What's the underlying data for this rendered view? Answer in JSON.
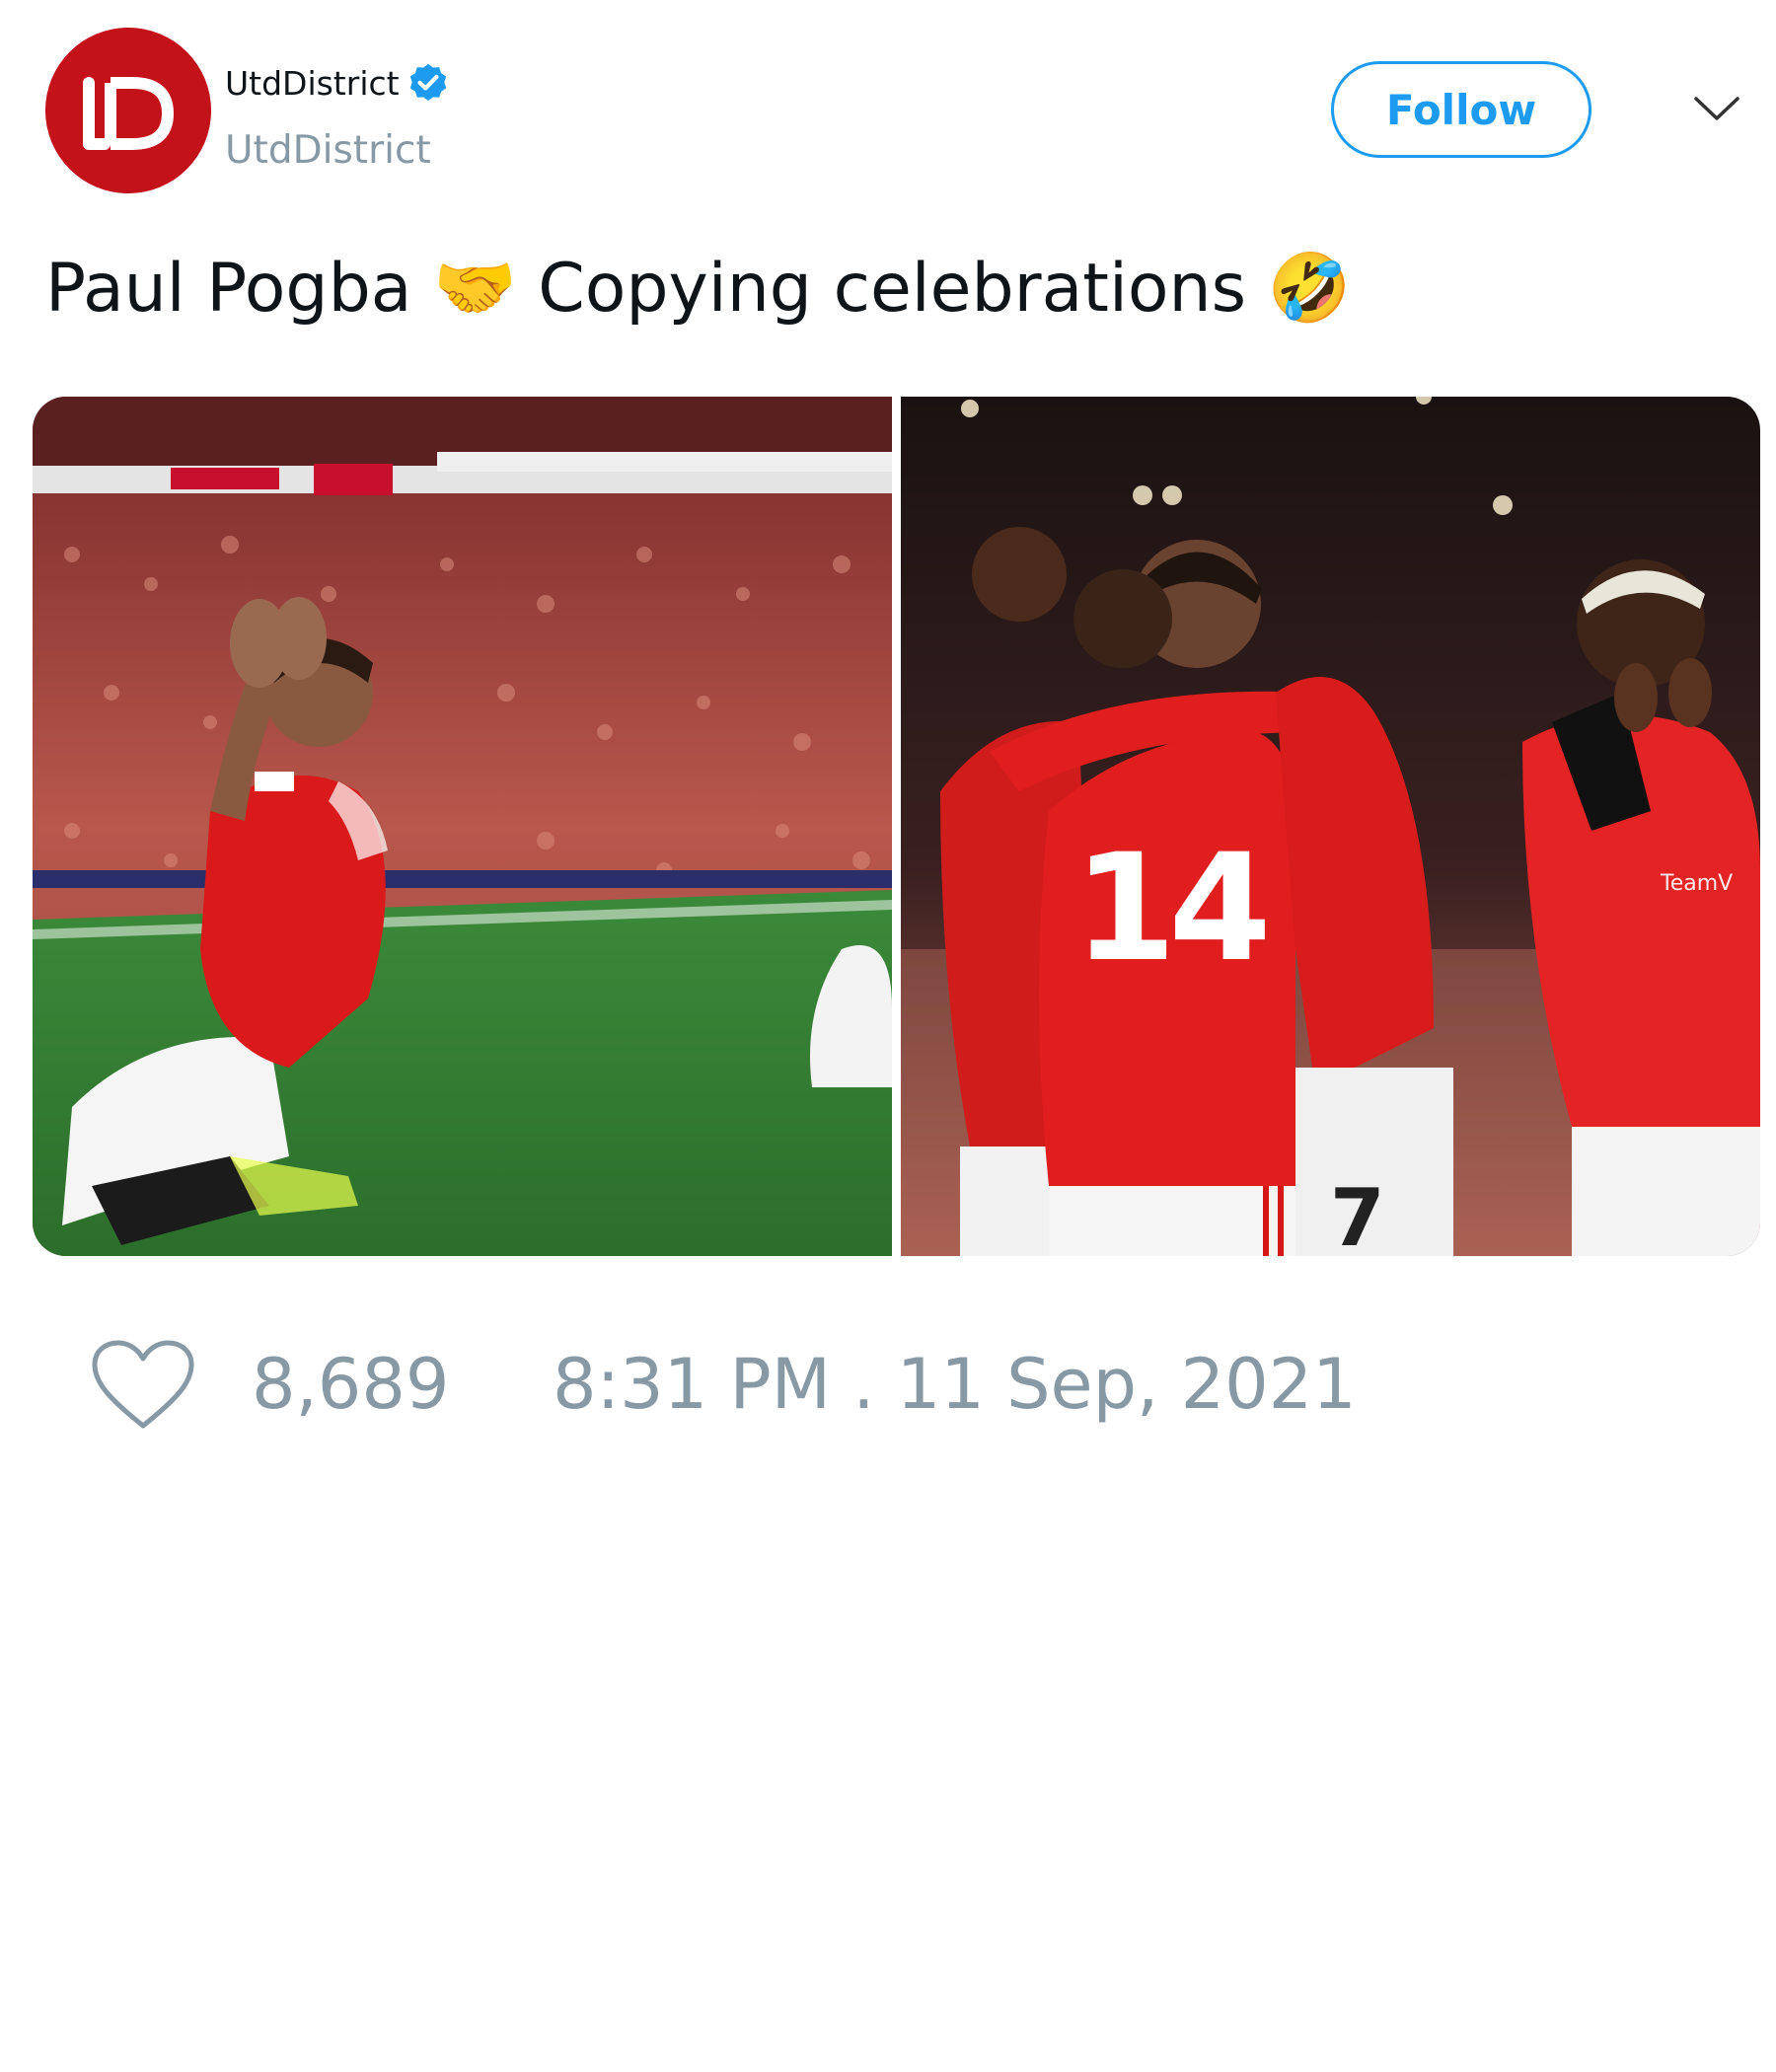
{
  "author": {
    "display_name": "UtdDistrict",
    "handle": "UtdDistrict",
    "verified": true,
    "avatar_icon": "utddistrict-logo",
    "avatar_color": "#c4121a"
  },
  "header": {
    "follow_label": "Follow",
    "menu_icon": "chevron-down-icon"
  },
  "tweet": {
    "text": "Paul Pogba 🤝 Copying celebrations 🤣"
  },
  "media": {
    "photos": [
      {
        "subject": "player-kneeling-celebration"
      },
      {
        "subject": "players-group-celebration"
      }
    ]
  },
  "footer": {
    "like_icon": "heart-icon",
    "like_count": "8,689",
    "timestamp": "8:31 PM . 11 Sep, 2021"
  },
  "colors": {
    "accent": "#1d9bf0",
    "muted": "#8899a6",
    "text": "#0f1419"
  }
}
